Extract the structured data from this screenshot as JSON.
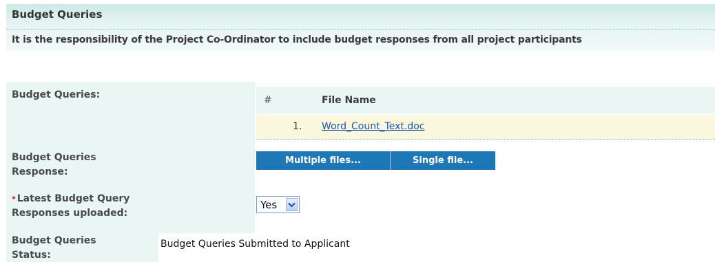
{
  "section": {
    "title": "Budget Queries",
    "instruction": "It is the responsibility of the Project Co-Ordinator to include budget responses from all project participants"
  },
  "fields": {
    "budget_queries_label": "Budget Queries:",
    "budget_queries_response_label_line1": "Budget Queries",
    "budget_queries_response_label_line2": "Response:",
    "latest_uploaded_required_marker": "*",
    "latest_uploaded_label_line1": "Latest Budget Query",
    "latest_uploaded_label_line2": "Responses uploaded:",
    "status_label_line1": "Budget Queries",
    "status_label_line2": "Status:"
  },
  "files_table": {
    "columns": [
      "#",
      "File Name"
    ],
    "rows": [
      {
        "index": "1.",
        "file_name": "Word_Count_Text.doc"
      }
    ]
  },
  "upload_buttons": {
    "multiple": "Multiple files...",
    "single": "Single file..."
  },
  "latest_uploaded_select": {
    "selected": "Yes",
    "icon": "chevron-down-icon"
  },
  "status": {
    "value": "Budget Queries Submitted to Applicant"
  },
  "colors": {
    "header_band": "#cbe9e5",
    "label_column": "#e9f6f4",
    "file_row": "#fbf7dc",
    "button_bar": "#1d78b5",
    "link": "#1a56b7",
    "required": "#dd1111"
  }
}
